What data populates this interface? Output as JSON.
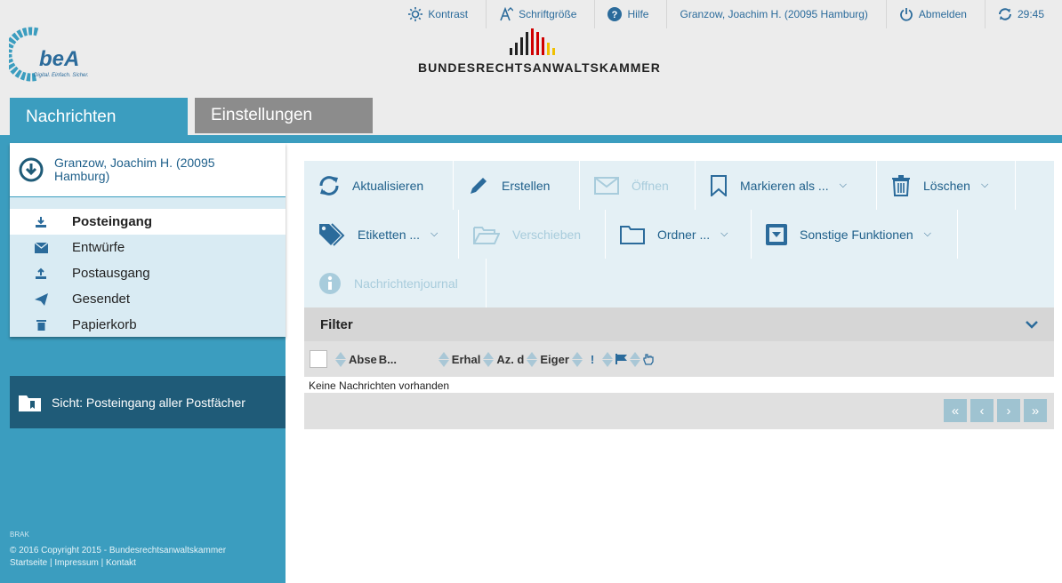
{
  "header": {
    "utilities": [
      {
        "name": "kontrast",
        "label": "Kontrast",
        "icon": "sun-icon"
      },
      {
        "name": "schriftgroesse",
        "label": "Schriftgröße",
        "icon": "font-size-icon"
      },
      {
        "name": "hilfe",
        "label": "Hilfe",
        "icon": "help-icon"
      },
      {
        "name": "user",
        "label": "Granzow, Joachim H. (20095 Hamburg)"
      },
      {
        "name": "abmelden",
        "label": "Abmelden",
        "icon": "power-icon"
      },
      {
        "name": "session",
        "label": "29:45",
        "icon": "refresh-icon"
      }
    ],
    "logo_text": "beA",
    "logo_tagline": "Digital. Einfach. Sicher.",
    "org_name": "BUNDESRECHTSANWALTSKAMMER"
  },
  "tabs": [
    {
      "label": "Nachrichten",
      "active": true
    },
    {
      "label": "Einstellungen",
      "active": false
    }
  ],
  "sidebar": {
    "mailbox_name": "Granzow, Joachim H. (20095 Hamburg)",
    "folders": [
      {
        "label": "Posteingang",
        "icon": "inbox-download-icon",
        "active": true
      },
      {
        "label": "Entwürfe",
        "icon": "envelope-icon",
        "active": false
      },
      {
        "label": "Postausgang",
        "icon": "outbox-upload-icon",
        "active": false
      },
      {
        "label": "Gesendet",
        "icon": "paper-plane-icon",
        "active": false
      },
      {
        "label": "Papierkorb",
        "icon": "trash-icon",
        "active": false
      }
    ],
    "view_label": "Sicht: Posteingang aller Postfächer",
    "footer": {
      "brak_mini": "BRAK",
      "copyright": "© 2016 Copyright 2015 - Bundesrechtsanwaltskammer",
      "links": [
        "Startseite",
        "Impressum",
        "Kontakt"
      ]
    }
  },
  "toolbar": {
    "aktualisieren": "Aktualisieren",
    "erstellen": "Erstellen",
    "oeffnen": "Öffnen",
    "markieren": "Markieren als ...",
    "loeschen": "Löschen",
    "etiketten": "Etiketten ...",
    "verschieben": "Verschieben",
    "ordner": "Ordner ...",
    "sonstige": "Sonstige Funktionen",
    "journal": "Nachrichtenjournal"
  },
  "filter": {
    "label": "Filter"
  },
  "table": {
    "columns": [
      "Abse",
      "B...",
      "Erhal",
      "Az. d",
      "Eiger",
      "!"
    ],
    "empty_text": "Keine Nachrichten vorhanden"
  },
  "pager": {
    "first": "«",
    "prev": "‹",
    "next": "›",
    "last": "»"
  },
  "colors": {
    "accent": "#3b9dbf",
    "dark": "#1f5b78",
    "text_blue": "#1e5f8a"
  }
}
